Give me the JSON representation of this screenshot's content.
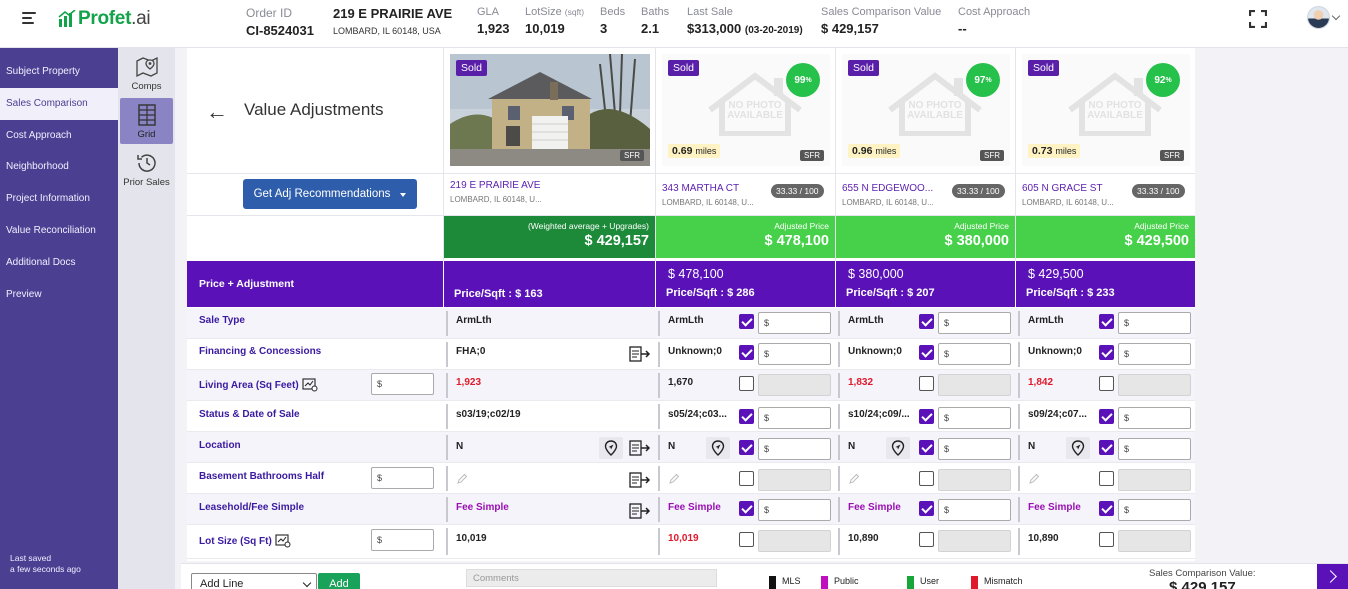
{
  "app": {
    "logo_text": "Profet",
    "logo_suffix": ".ai",
    "brand_color": "#13a34a"
  },
  "header": {
    "order_label": "Order ID",
    "order_id": "CI-8524031",
    "address_street": "219 E PRAIRIE AVE",
    "address_city": "LOMBARD, IL 60148, USA",
    "gla_label": "GLA",
    "gla_value": "1,923",
    "lot_label": "LotSize",
    "lot_unit": "(sqft)",
    "lot_value": "10,019",
    "beds_label": "Beds",
    "beds_value": "3",
    "baths_label": "Baths",
    "baths_value": "2.1",
    "last_sale_label": "Last Sale",
    "last_sale_value": "$313,000",
    "last_sale_date": "(03-20-2019)",
    "scv_label": "Sales Comparison Value",
    "scv_value": "$ 429,157",
    "cost_label": "Cost Approach",
    "cost_value": "--"
  },
  "sidebar": {
    "items": [
      {
        "label": "Subject Property"
      },
      {
        "label": "Sales Comparison",
        "active": true
      },
      {
        "label": "Cost Approach"
      },
      {
        "label": "Neighborhood"
      },
      {
        "label": "Project Information"
      },
      {
        "label": "Value Reconciliation"
      },
      {
        "label": "Additional Docs"
      },
      {
        "label": "Preview"
      }
    ],
    "saved_line1": "Last saved",
    "saved_line2": "a few seconds ago"
  },
  "rail": {
    "items": [
      {
        "label": "Comps",
        "icon": "map-pin-icon"
      },
      {
        "label": "Grid",
        "icon": "grid-icon",
        "active": true
      },
      {
        "label": "Prior Sales",
        "icon": "history-icon"
      }
    ]
  },
  "grid": {
    "title": "Value Adjustments",
    "adj_button": "Get Adj Recommendations",
    "subject": {
      "badge": "Sold",
      "type": "SFR",
      "street": "219 E PRAIRIE AVE",
      "city": "LOMBARD, IL 60148, U...",
      "banner_sub": "(Weighted average + Upgrades)",
      "banner_value": "$ 429,157",
      "psf": "Price/Sqft : $ 163"
    },
    "comps": [
      {
        "badge": "Sold",
        "type": "SFR",
        "match": "99",
        "miles": "0.69",
        "street": "343 MARTHA CT",
        "city": "LOMBARD, IL 60148, U...",
        "score": "33.33 / 100",
        "banner_sub": "Adjusted Price",
        "banner_value": "$ 478,100",
        "price": "$ 478,100",
        "psf": "Price/Sqft : $ 286"
      },
      {
        "badge": "Sold",
        "type": "SFR",
        "match": "97",
        "miles": "0.96",
        "street": "655 N EDGEWOO...",
        "city": "LOMBARD, IL 60148, U...",
        "score": "33.33 / 100",
        "banner_sub": "Adjusted Price",
        "banner_value": "$ 380,000",
        "price": "$ 380,000",
        "psf": "Price/Sqft : $ 207"
      },
      {
        "badge": "Sold",
        "type": "SFR",
        "match": "92",
        "miles": "0.73",
        "street": "605 N GRACE ST",
        "city": "LOMBARD, IL 60148, U...",
        "score": "33.33 / 100",
        "banner_sub": "Adjusted Price",
        "banner_value": "$ 429,500",
        "price": "$ 429,500",
        "psf": "Price/Sqft : $ 233"
      }
    ],
    "no_photo_line1": "NO PHOTO",
    "no_photo_line2": "AVAILABLE",
    "match_unit": "%",
    "miles_unit": "miles",
    "header_row_label": "Price + Adjustment",
    "dollar": "$",
    "rows": [
      {
        "label": "Sale Type",
        "subject": "ArmLth",
        "comps": [
          "ArmLth",
          "ArmLth",
          "ArmLth"
        ]
      },
      {
        "label": "Financing & Concessions",
        "subject": "FHA;0",
        "comps": [
          "Unknown;0",
          "Unknown;0",
          "Unknown;0"
        ]
      },
      {
        "label": "Living Area (Sq Feet)",
        "subject": "1,923",
        "comps": [
          "1,670",
          "1,832",
          "1,842"
        ]
      },
      {
        "label": "Status & Date of Sale",
        "subject": "s03/19;c02/19",
        "comps": [
          "s05/24;c03...",
          "s10/24;c09/...",
          "s09/24;c07..."
        ]
      },
      {
        "label": "Location",
        "subject": "N",
        "comps": [
          "N",
          "N",
          "N"
        ]
      },
      {
        "label": "Basement Bathrooms Half",
        "subject": "",
        "comps": [
          "",
          "",
          ""
        ]
      },
      {
        "label": "Leasehold/Fee Simple",
        "subject": "Fee Simple",
        "comps": [
          "Fee Simple",
          "Fee Simple",
          "Fee Simple"
        ]
      },
      {
        "label": "Lot Size (Sq Ft)",
        "subject": "10,019",
        "comps": [
          "10,019",
          "10,890",
          "10,890"
        ]
      }
    ]
  },
  "footer": {
    "add_line": "Add Line",
    "add_button": "Add",
    "comments_placeholder": "Comments",
    "legend": [
      {
        "label": "MLS",
        "color": "#111111"
      },
      {
        "label": "Public",
        "color": "#c10fbf"
      },
      {
        "label": "User",
        "color": "#18a63b"
      },
      {
        "label": "Mismatch",
        "color": "#e0192a"
      }
    ],
    "scv_label": "Sales Comparison Value:",
    "scv_value": "$ 429,157"
  }
}
